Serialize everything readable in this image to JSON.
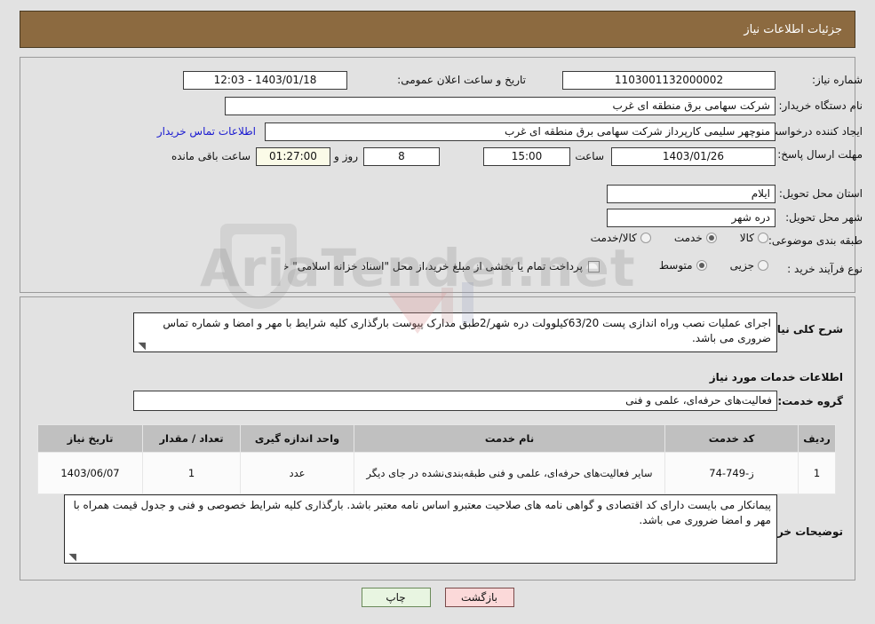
{
  "header": {
    "title": "جزئیات اطلاعات نیاز"
  },
  "colors": {
    "header_bg": "#8c6a40",
    "page_bg": "#e2e2e2",
    "link": "#1a1ad0",
    "table_header_bg": "#c0c0c0",
    "countdown_bg": "#fbfbe8",
    "btn_print_bg": "#e8f5e1",
    "btn_back_bg": "#fbd9d9"
  },
  "form": {
    "need_number_label": "شماره نیاز:",
    "need_number_value": "1103001132000002",
    "public_announce_label": "تاریخ و ساعت اعلان عمومی:",
    "public_announce_value": "12:03 - 1403/01/18",
    "buyer_org_label": "نام دستگاه خریدار:",
    "buyer_org_value": "شرکت سهامی برق منطقه ای غرب",
    "requester_label": "ایجاد کننده درخواست:",
    "requester_value": "منوچهر  سلیمی کارپرداز شرکت سهامی برق منطقه ای غرب",
    "buyer_contact_link": "اطلاعات تماس خریدار",
    "deadline_label": "مهلت ارسال پاسخ: تا تاریخ:",
    "deadline_date": "1403/01/26",
    "deadline_hour_label": "ساعت",
    "deadline_hour_value": "15:00",
    "days_value": "8",
    "days_label": "روز و",
    "countdown_value": "01:27:00",
    "countdown_label": "ساعت باقی مانده",
    "province_label": "استان محل تحویل:",
    "province_value": "ایلام",
    "city_label": "شهر محل تحویل:",
    "city_value": "دره شهر",
    "category_label": "طبقه بندی موضوعی:",
    "category_options": [
      {
        "label": "کالا",
        "selected": false
      },
      {
        "label": "خدمت",
        "selected": true
      },
      {
        "label": "کالا/خدمت",
        "selected": false
      }
    ],
    "process_label": "نوع فرآیند خرید :",
    "process_options": [
      {
        "label": "جزیی",
        "selected": false
      },
      {
        "label": "متوسط",
        "selected": true
      }
    ],
    "treasury_checkbox_label": "پرداخت تمام یا بخشی از مبلغ خرید،از محل \"اسناد خزانه اسلامی\" خواهد بود.",
    "treasury_checked": false
  },
  "description": {
    "label": "شرح کلی نیاز:",
    "text": "اجرای عملیات نصب وراه اندازی پست 63/20کیلوولت دره شهر/2طبق مدارک پیوست بارگذاری کلیه شرایط  با مهر و امضا و شماره تماس ضروری می باشد."
  },
  "services_section": {
    "title": "اطلاعات خدمات مورد نیاز",
    "group_label": "گروه خدمت:",
    "group_value": "فعالیت‌های حرفه‌ای، علمی و فنی"
  },
  "table": {
    "columns": [
      "ردیف",
      "کد خدمت",
      "نام خدمت",
      "واحد اندازه گیری",
      "تعداد / مقدار",
      "تاریخ نیاز"
    ],
    "rows": [
      {
        "row_no": "1",
        "service_code": "ز-749-74",
        "service_name": "سایر فعالیت‌های حرفه‌ای، علمی و فنی طبقه‌بندی‌نشده در جای دیگر",
        "unit": "عدد",
        "quantity": "1",
        "need_date": "1403/06/07"
      }
    ]
  },
  "buyer_notes": {
    "label": "توضیحات خریدار:",
    "text": "پیمانکار می بایست دارای کد اقتصادی و گواهی نامه های صلاحیت معتبرو اساس نامه معتبر  باشد. بارگذاری کلیه شرایط خصوصی و فنی و جدول قیمت همراه با مهر و امضا ضروری می باشد."
  },
  "buttons": {
    "print": "چاپ",
    "back": "بازگشت"
  },
  "watermark": {
    "text": "AriaTender.net"
  }
}
